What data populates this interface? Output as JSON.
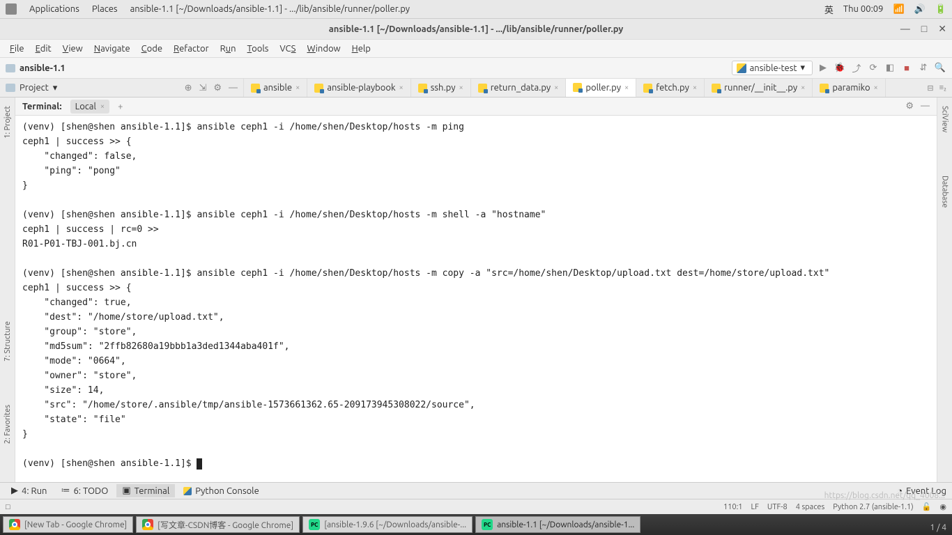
{
  "gnome": {
    "applications": "Applications",
    "places": "Places",
    "window_title": "ansible-1.1 [~/Downloads/ansible-1.1] - .../lib/ansible/runner/poller.py",
    "ime": "英",
    "clock": "Thu 00:09"
  },
  "window": {
    "title": "ansible-1.1 [~/Downloads/ansible-1.1] - .../lib/ansible/runner/poller.py"
  },
  "menu": {
    "file": "File",
    "edit": "Edit",
    "view": "View",
    "navigate": "Navigate",
    "code": "Code",
    "refactor": "Refactor",
    "run": "Run",
    "tools": "Tools",
    "vcs": "VCS",
    "window": "Window",
    "help": "Help"
  },
  "breadcrumb": {
    "root": "ansible-1.1"
  },
  "runconfig": {
    "name": "ansible-test"
  },
  "project_switcher": {
    "label": "Project"
  },
  "tabs": [
    {
      "label": "ansible",
      "active": false
    },
    {
      "label": "ansible-playbook",
      "active": false
    },
    {
      "label": "ssh.py",
      "active": false
    },
    {
      "label": "return_data.py",
      "active": false
    },
    {
      "label": "poller.py",
      "active": true
    },
    {
      "label": "fetch.py",
      "active": false
    },
    {
      "label": "runner/__init__.py",
      "active": false
    },
    {
      "label": "paramiko",
      "active": false
    }
  ],
  "side_left": {
    "project": "1: Project",
    "structure": "7: Structure",
    "favorites": "2: Favorites"
  },
  "side_right": {
    "sciview": "SciView",
    "database": "Database"
  },
  "terminal": {
    "header": "Terminal:",
    "tab_local": "Local",
    "lines": [
      "(venv) [shen@shen ansible-1.1]$ ansible ceph1 -i /home/shen/Desktop/hosts -m ping",
      "ceph1 | success >> {",
      "    \"changed\": false,",
      "    \"ping\": \"pong\"",
      "}",
      "",
      "(venv) [shen@shen ansible-1.1]$ ansible ceph1 -i /home/shen/Desktop/hosts -m shell -a \"hostname\"",
      "ceph1 | success | rc=0 >>",
      "R01-P01-TBJ-001.bj.cn",
      "",
      "(venv) [shen@shen ansible-1.1]$ ansible ceph1 -i /home/shen/Desktop/hosts -m copy -a \"src=/home/shen/Desktop/upload.txt dest=/home/store/upload.txt\"",
      "ceph1 | success >> {",
      "    \"changed\": true,",
      "    \"dest\": \"/home/store/upload.txt\",",
      "    \"group\": \"store\",",
      "    \"md5sum\": \"2ffb82680a19bbb1a3ded1344aba401f\",",
      "    \"mode\": \"0664\",",
      "    \"owner\": \"store\",",
      "    \"size\": 14,",
      "    \"src\": \"/home/store/.ansible/tmp/ansible-1573661362.65-209173945308022/source\",",
      "    \"state\": \"file\"",
      "}",
      "",
      "(venv) [shen@shen ansible-1.1]$ "
    ]
  },
  "bottom": {
    "run": "4: Run",
    "todo": "6: TODO",
    "terminal": "Terminal",
    "python": "Python Console",
    "eventlog": "Event Log"
  },
  "status": {
    "pos": "110:1",
    "le": "LF",
    "enc": "UTF-8",
    "indent": "4 spaces",
    "sdk": "Python 2.7 (ansible-1.1)"
  },
  "taskbar": [
    {
      "label": "[New Tab - Google Chrome]",
      "icon": "chrome",
      "active": false
    },
    {
      "label": "[写文章-CSDN博客 - Google Chrome]",
      "icon": "chrome",
      "active": false
    },
    {
      "label": "[ansible-1.9.6 [~/Downloads/ansible-...",
      "icon": "pycharm",
      "active": false
    },
    {
      "label": "ansible-1.1 [~/Downloads/ansible-1...",
      "icon": "pycharm",
      "active": true
    }
  ],
  "watermark": "https://blog.csdn.net/qq_4008...",
  "page_indicator": "1 / 4"
}
